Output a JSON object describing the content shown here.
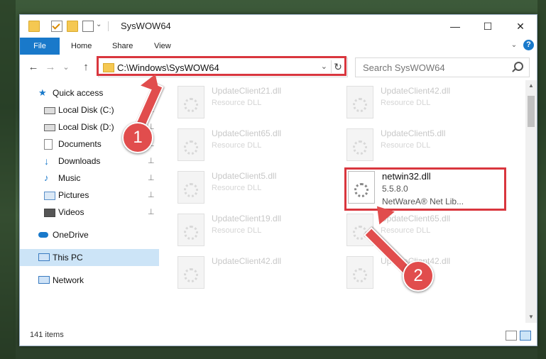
{
  "window": {
    "title": "SysWOW64"
  },
  "window_controls": {
    "minimize": "—",
    "maximize": "☐",
    "close": "✕"
  },
  "ribbon": {
    "file": "File",
    "home": "Home",
    "share": "Share",
    "view": "View",
    "help": "?"
  },
  "nav": {
    "back": "←",
    "forward": "→",
    "recent": "⌄",
    "up": "↑",
    "address": "C:\\Windows\\SysWOW64",
    "address_dropdown": "⌄",
    "refresh": "↻",
    "search_placeholder": "Search SysWOW64"
  },
  "sidebar": {
    "items": [
      {
        "label": "Quick access",
        "icon": "star-icon",
        "pinned": false
      },
      {
        "label": "Local Disk (C:)",
        "icon": "drive-icon",
        "pinned": true
      },
      {
        "label": "Local Disk (D:)",
        "icon": "drive-icon",
        "pinned": true
      },
      {
        "label": "Documents",
        "icon": "documents-icon",
        "pinned": true
      },
      {
        "label": "Downloads",
        "icon": "download-icon",
        "pinned": true
      },
      {
        "label": "Music",
        "icon": "music-icon",
        "pinned": true
      },
      {
        "label": "Pictures",
        "icon": "pictures-icon",
        "pinned": true
      },
      {
        "label": "Videos",
        "icon": "videos-icon",
        "pinned": true
      },
      {
        "label": "OneDrive",
        "icon": "cloud-icon",
        "pinned": false
      },
      {
        "label": "This PC",
        "icon": "computer-icon",
        "pinned": false,
        "selected": true
      },
      {
        "label": "Network",
        "icon": "network-icon",
        "pinned": false
      }
    ],
    "pin_glyph": "📌"
  },
  "files": [
    {
      "name": "UpdateClient21.dll",
      "type": "Resource DLL"
    },
    {
      "name": "UpdateClient42.dll",
      "type": "Resource DLL"
    },
    {
      "name": "UpdateClient65.dll",
      "type": "Resource DLL"
    },
    {
      "name": "UpdateClient5.dll",
      "type": "Resource DLL"
    },
    {
      "name": "UpdateClient5.dll",
      "type": "Resource DLL"
    },
    {
      "name": "netwin32.dll",
      "version": "5.5.8.0",
      "description": "NetWareA® Net Lib...",
      "highlighted": true
    },
    {
      "name": "UpdateClient19.dll",
      "type": "Resource DLL"
    },
    {
      "name": "UpdateClient65.dll",
      "type": "Resource DLL"
    },
    {
      "name": "UpdateClient42.dll",
      "type": ""
    },
    {
      "name": "UpdateClient42.dll",
      "type": ""
    }
  ],
  "status": {
    "item_count": "141 items"
  },
  "callouts": {
    "one": "1",
    "two": "2"
  },
  "colors": {
    "accent": "#1979ca",
    "highlight": "#d9363e",
    "selected": "#cce4f7"
  }
}
